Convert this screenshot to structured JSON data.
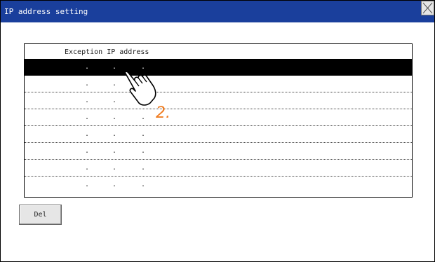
{
  "window": {
    "title": "IP address setting",
    "close_icon": "close-x-icon"
  },
  "table": {
    "header": "Exception IP address",
    "rows": [
      {
        "separators": [
          ".",
          ".",
          "."
        ],
        "selected": true
      },
      {
        "separators": [
          ".",
          ".",
          "."
        ],
        "selected": false
      },
      {
        "separators": [
          ".",
          ".",
          "."
        ],
        "selected": false
      },
      {
        "separators": [
          ".",
          ".",
          "."
        ],
        "selected": false
      },
      {
        "separators": [
          ".",
          ".",
          "."
        ],
        "selected": false
      },
      {
        "separators": [
          ".",
          ".",
          "."
        ],
        "selected": false
      },
      {
        "separators": [
          ".",
          ".",
          "."
        ],
        "selected": false
      },
      {
        "separators": [
          ".",
          ".",
          "."
        ],
        "selected": false
      }
    ]
  },
  "annotation": {
    "step": "2.",
    "pointer_icon": "hand-pointer-icon",
    "color": "#f07d22"
  },
  "buttons": {
    "del_label": "Del"
  },
  "colors": {
    "titlebar": "#1a3f9c",
    "selected_row": "#000000"
  }
}
